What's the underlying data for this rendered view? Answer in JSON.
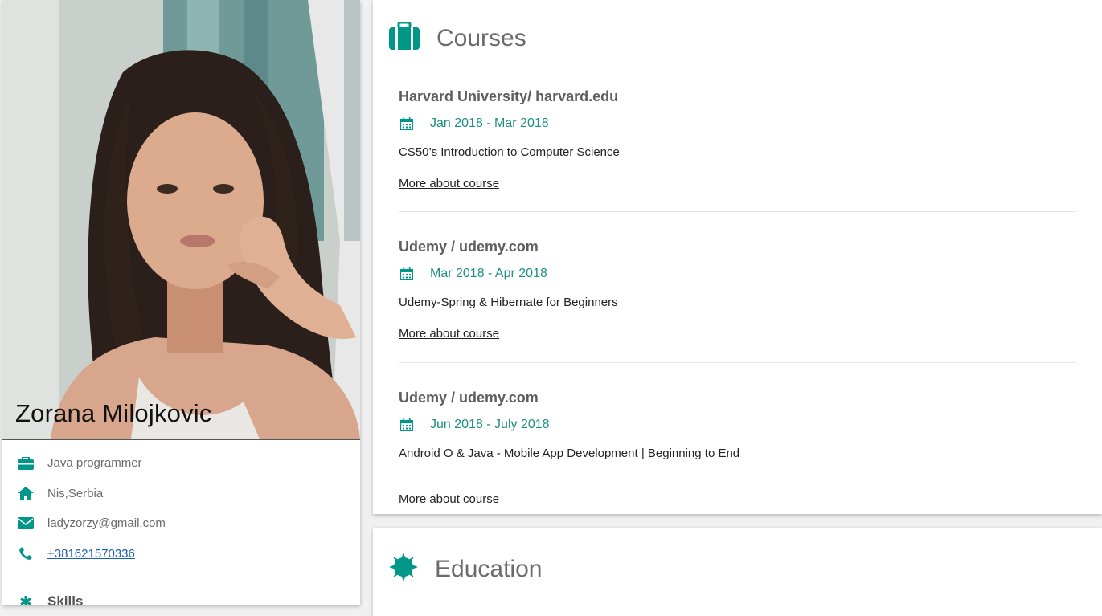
{
  "profile": {
    "name": "Zorana Milojkovic",
    "job": "Java programmer",
    "location": "Nis,Serbia",
    "email": "ladyzorzy@gmail.com",
    "phone": "+381621570336",
    "skills_label": "Skills"
  },
  "courses": {
    "title": "Courses",
    "items": [
      {
        "org": "Harvard University/ harvard.edu",
        "dates": "Jan 2018 - Mar 2018",
        "description": "CS50’s Introduction to Computer Science",
        "link": "More about course"
      },
      {
        "org": "Udemy / udemy.com",
        "dates": "Mar 2018 - Apr 2018",
        "description": "Udemy-Spring & Hibernate for Beginners",
        "link": "More about course"
      },
      {
        "org": "Udemy / udemy.com",
        "dates": "Jun 2018 - July 2018",
        "description": "Android O & Java - Mobile App Development | Beginning to End",
        "link": "More about course"
      }
    ]
  },
  "education": {
    "title": "Education"
  },
  "theme": {
    "accent": "#009688",
    "link": "#1a5fae"
  }
}
